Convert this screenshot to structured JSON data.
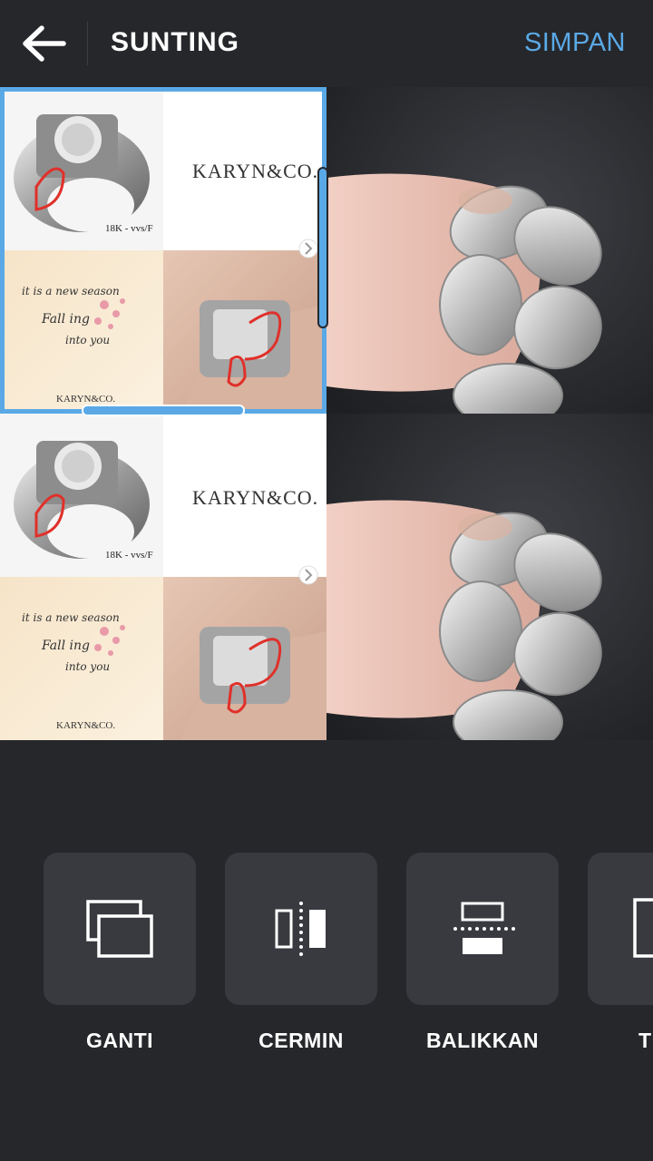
{
  "header": {
    "title": "SUNTING",
    "save_label": "SIMPAN",
    "back_icon": "arrow-left-icon"
  },
  "collage": {
    "cells": [
      {
        "type": "jewelry-poster",
        "brand": "KARYN&CO.",
        "grade": "18K - vvs/F",
        "script_line1": "it is a new season",
        "script_line2": "Fall ing",
        "script_line3": "into you",
        "footer_brand": "KARYN&CO."
      },
      {
        "type": "photo",
        "subject": "silver chain ring on finger"
      },
      {
        "type": "jewelry-poster",
        "brand": "KARYN&CO.",
        "grade": "18K - vvs/F",
        "script_line1": "it is a new season",
        "script_line2": "Fall ing",
        "script_line3": "into you",
        "footer_brand": "KARYN&CO."
      },
      {
        "type": "photo",
        "subject": "silver chain ring on finger"
      }
    ],
    "selected_cell": 0,
    "accent": "#5aa9e6"
  },
  "tools": [
    {
      "label": "GANTI",
      "icon": "replace-icon"
    },
    {
      "label": "CERMIN",
      "icon": "mirror-icon"
    },
    {
      "label": "BALIKKAN",
      "icon": "flip-vertical-icon"
    },
    {
      "label": "T",
      "icon": "rotate-icon"
    }
  ],
  "colors": {
    "background": "#26272b",
    "tile": "#393a40",
    "accent": "#5aa9e6"
  }
}
